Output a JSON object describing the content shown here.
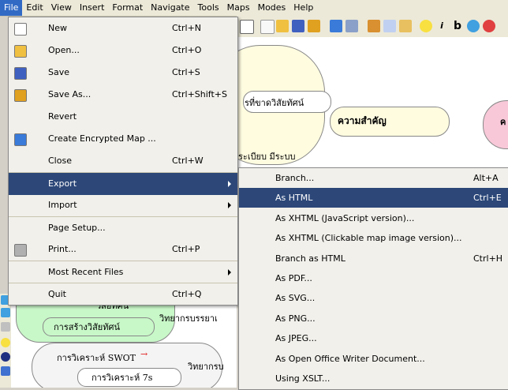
{
  "menubar": [
    "File",
    "Edit",
    "View",
    "Insert",
    "Format",
    "Navigate",
    "Tools",
    "Maps",
    "Modes",
    "Help"
  ],
  "file_menu": [
    {
      "label": "New",
      "shortcut": "Ctrl+N",
      "icon": "new-document-icon"
    },
    {
      "label": "Open...",
      "shortcut": "Ctrl+O",
      "icon": "open-folder-icon"
    },
    {
      "label": "Save",
      "shortcut": "Ctrl+S",
      "icon": "save-disk-icon"
    },
    {
      "label": "Save As...",
      "shortcut": "Ctrl+Shift+S",
      "icon": "save-as-icon"
    },
    {
      "label": "Revert",
      "shortcut": ""
    },
    {
      "label": "Create Encrypted Map ...",
      "shortcut": "",
      "icon": "lock-icon"
    },
    {
      "label": "Close",
      "shortcut": "Ctrl+W"
    },
    {
      "label": "Export",
      "shortcut": "",
      "submenu": true
    },
    {
      "label": "Import",
      "shortcut": "",
      "submenu": true
    },
    {
      "label": "Page Setup...",
      "shortcut": ""
    },
    {
      "label": "Print...",
      "shortcut": "Ctrl+P",
      "icon": "printer-icon"
    },
    {
      "label": "Most Recent Files",
      "shortcut": "",
      "submenu": true
    },
    {
      "label": "Quit",
      "shortcut": "Ctrl+Q"
    }
  ],
  "export_menu": [
    {
      "label": "Branch...",
      "shortcut": "Alt+A"
    },
    {
      "label": "As HTML",
      "shortcut": "Ctrl+E"
    },
    {
      "label": "As XHTML (JavaScript version)...",
      "shortcut": ""
    },
    {
      "label": "As XHTML (Clickable map image version)...",
      "shortcut": ""
    },
    {
      "label": "Branch as HTML",
      "shortcut": "Ctrl+H"
    },
    {
      "label": "As PDF...",
      "shortcut": ""
    },
    {
      "label": "As SVG...",
      "shortcut": ""
    },
    {
      "label": "As PNG...",
      "shortcut": ""
    },
    {
      "label": "As JPEG...",
      "shortcut": ""
    },
    {
      "label": "As Open Office Writer Document...",
      "shortcut": ""
    },
    {
      "label": "Using XSLT...",
      "shortcut": ""
    }
  ],
  "mindmap_top": {
    "node_1": "รที่ขาดวิสัยทัศน์",
    "node_2": "ความสำคัญ",
    "node_3": "ระเบียบ มีระบบ",
    "node_4": "ค"
  },
  "mindmap_bottom": {
    "node_1": "วิสัยทัศน์",
    "node_2": "วิทยากรบรรยาเ",
    "node_3": "การสร้างวิสัยทัศน์",
    "node_4": "การวิเคราะห์ SWOT",
    "node_5": "วิทยากรบ",
    "node_6": "การวิเคราะห์ 7s"
  },
  "colors": {
    "highlight": "#2c4778",
    "menubar_active": "#316ac5",
    "bubble_yellow": "#fffce0",
    "bubble_green": "#c8f7c8",
    "bubble_pink": "#f8c8d8"
  }
}
